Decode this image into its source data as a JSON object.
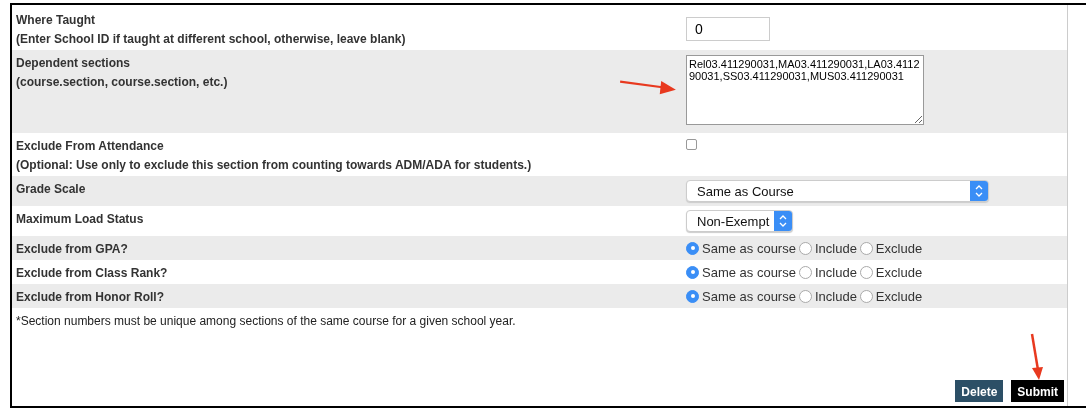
{
  "rows": [
    {
      "kind": "text",
      "label": "Where Taught",
      "hint": "(Enter School ID if taught at different school, otherwise, leave blank)",
      "value": "0"
    },
    {
      "kind": "textarea",
      "label": "Dependent sections",
      "hint": "(course.section, course.section, etc.)",
      "value": "Rel03.411290031,MA03.411290031,LA03.411290031,SS03.411290031,MUS03.411290031"
    },
    {
      "kind": "checkbox",
      "label": "Exclude From Attendance",
      "hint": "(Optional: Use only to exclude this section from counting towards ADM/ADA for students.)",
      "checked": false
    },
    {
      "kind": "select",
      "label": "Grade Scale",
      "value": "Same as Course",
      "wide": true
    },
    {
      "kind": "select",
      "label": "Maximum Load Status",
      "value": "Non-Exempt",
      "wide": false
    },
    {
      "kind": "radio",
      "label": "Exclude from GPA?",
      "options": [
        {
          "label": "Same as course",
          "selected": true
        },
        {
          "label": "Include",
          "selected": false
        },
        {
          "label": "Exclude",
          "selected": false
        }
      ]
    },
    {
      "kind": "radio",
      "label": "Exclude from Class Rank?",
      "options": [
        {
          "label": "Same as course",
          "selected": true
        },
        {
          "label": "Include",
          "selected": false
        },
        {
          "label": "Exclude",
          "selected": false
        }
      ]
    },
    {
      "kind": "radio",
      "label": "Exclude from Honor Roll?",
      "options": [
        {
          "label": "Same as course",
          "selected": true
        },
        {
          "label": "Include",
          "selected": false
        },
        {
          "label": "Exclude",
          "selected": false
        }
      ]
    }
  ],
  "note": "*Section numbers must be unique among sections of the same course for a given school year.",
  "buttons": [
    {
      "label": "Delete",
      "kind": "secondary"
    },
    {
      "label": "Submit",
      "kind": "primary"
    }
  ]
}
